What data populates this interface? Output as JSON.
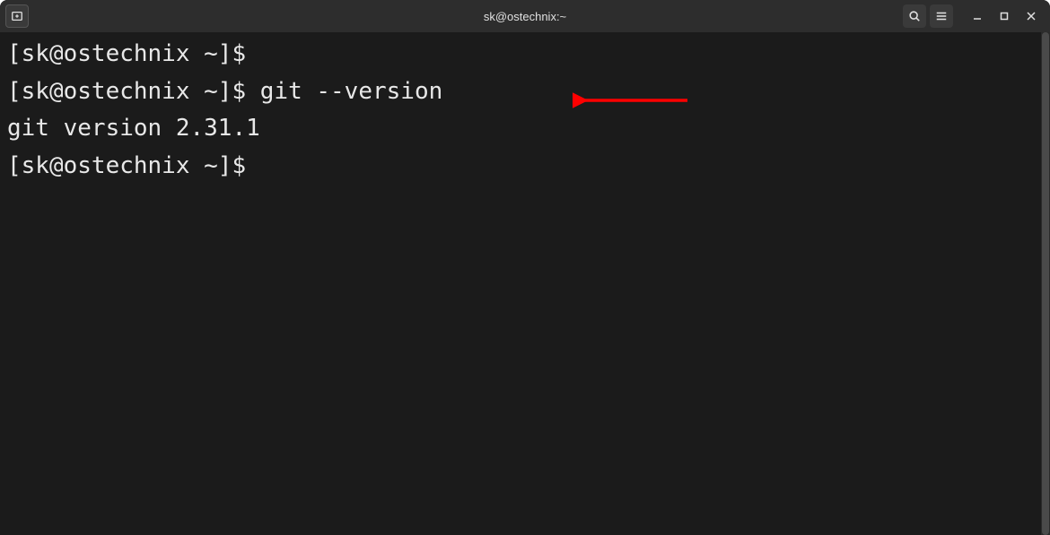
{
  "window": {
    "title": "sk@ostechnix:~"
  },
  "terminal": {
    "lines": [
      {
        "prompt": "[sk@ostechnix ~]$ ",
        "command": ""
      },
      {
        "prompt": "[sk@ostechnix ~]$ ",
        "command": "git --version"
      },
      {
        "prompt": "",
        "command": "git version 2.31.1"
      },
      {
        "prompt": "[sk@ostechnix ~]$ ",
        "command": ""
      }
    ]
  },
  "annotation": {
    "color": "#ff0000"
  }
}
